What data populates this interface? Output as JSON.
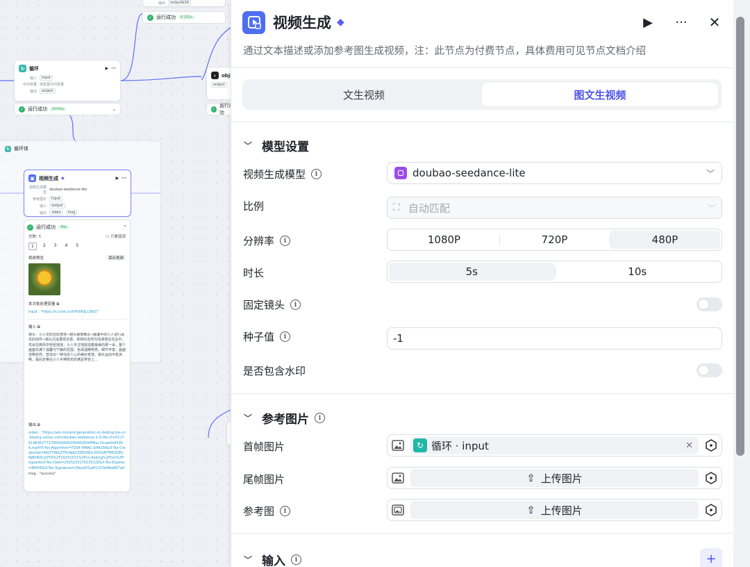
{
  "canvas": {
    "top_node": {
      "chip": "output&16",
      "status": "运行成功",
      "time": "0.151s"
    },
    "loop_node": {
      "title": "循环",
      "rows": [
        {
          "k": "输入",
          "v": "input"
        },
        {
          "k": "中间变量",
          "v": "未配置中间变量"
        },
        {
          "k": "输出",
          "v": "output"
        }
      ],
      "status": "运行成功",
      "time": "2m41s"
    },
    "obj_node": {
      "title": "objs",
      "chip": "output",
      "status": "运行成功"
    },
    "loop_body": {
      "title": "循环体"
    },
    "video_node": {
      "title": "视频生成",
      "rows": [
        {
          "k": "视频生成模型",
          "v": "doubao-seedance-lite"
        },
        {
          "k": "参考图片",
          "v": "input"
        },
        {
          "k": "输入",
          "v": "output"
        },
        {
          "k": "输出",
          "v": "video",
          "v2": "msg"
        }
      ]
    },
    "result": {
      "status": "运行成功",
      "time": "44s",
      "total": "总数: 5",
      "only_error": "只看错误",
      "pages": [
        "1",
        "2",
        "3",
        "4",
        "5"
      ],
      "preview_label": "视频预览",
      "save_label": "保存视频",
      "batch_label": "本次批处理变量",
      "batch_value": "input : \"https://s.coze.cn/t/FoDRJLc3bQ/\"",
      "input_label": "输入",
      "input_text": "镜头：小人花的治愈意境→镜头缓慢推近→画面中的小人进行采花的动作→镜头拉远展现全景，柔和的自然光线洒落在花丛中，花朵在微风中轻轻摇曳，小人专注地挑选着最美的那一朵，整个画面充满了温馨与宁静的氛围，色调温暖明亮，细节丰富，画面流畅自然，营造出一种治愈人心的美好意境，镜头运动平稳流畅，最后定格在小人手捧鲜花的满足笑容上…",
      "output_label": "输出",
      "output_video": "video : \"https://ark-content-generation-cn-beijing.tos-cn-beijing.volces.com/doubao-seedance-1-0-lite-i2v/02176196362771700000000000000000ffffac15cae0e95366.mp4?X-Tos-Algorithm=TOS4-HMAC-SHA256&X-Tos-Credential=AKLTYWJhZTExNjA2ZDEzNDc3OGIzNTM5ODEyNjBhNDczOTQ%2F20251031%2Fcn-beijing%2Ftos%2Frequest&X-Tos-Date=20251031T023512Z&X-Tos-Expires=86400&X-Tos-Signature=29ea201a4f11f7ef4ba897a93b3fa67f6e47023d0295fff1fa3e56cbf7b0d0ff4d&X-Tos-SignedHeaders=host\"",
      "output_msg": "msg : \"success\""
    }
  },
  "panel": {
    "title": "视频生成",
    "description": "通过文本描述或添加参考图生成视频，注：此节点为付费节点，具体费用可见节点文档介绍",
    "tabs": [
      {
        "label": "文生视频",
        "active": false
      },
      {
        "label": "图文生视频",
        "active": true
      }
    ],
    "model_section": "模型设置",
    "model_label": "视频生成模型",
    "model_value": "doubao-seedance-lite",
    "ratio_label": "比例",
    "ratio_value": "自动匹配",
    "resolution_label": "分辨率",
    "resolutions": [
      {
        "label": "1080P",
        "active": false
      },
      {
        "label": "720P",
        "active": false
      },
      {
        "label": "480P",
        "active": true
      }
    ],
    "duration_label": "时长",
    "durations": [
      {
        "label": "5s",
        "active": true
      },
      {
        "label": "10s",
        "active": false
      }
    ],
    "fixed_camera_label": "固定镜头",
    "fixed_camera_on": false,
    "seed_label": "种子值",
    "seed_value": "-1",
    "watermark_label": "是否包含水印",
    "watermark_on": false,
    "ref_section": "参考图片",
    "first_frame_label": "首帧图片",
    "first_frame_var": "循环 · input",
    "last_frame_label": "尾帧图片",
    "ref_image_label": "参考图",
    "upload_label": "上传图片",
    "input_section": "输入"
  },
  "colors": {
    "accent": "#4d53e8",
    "node_teal": "#3cb7ad",
    "success": "#2fb36b",
    "model_purple": "#9b4dea"
  }
}
